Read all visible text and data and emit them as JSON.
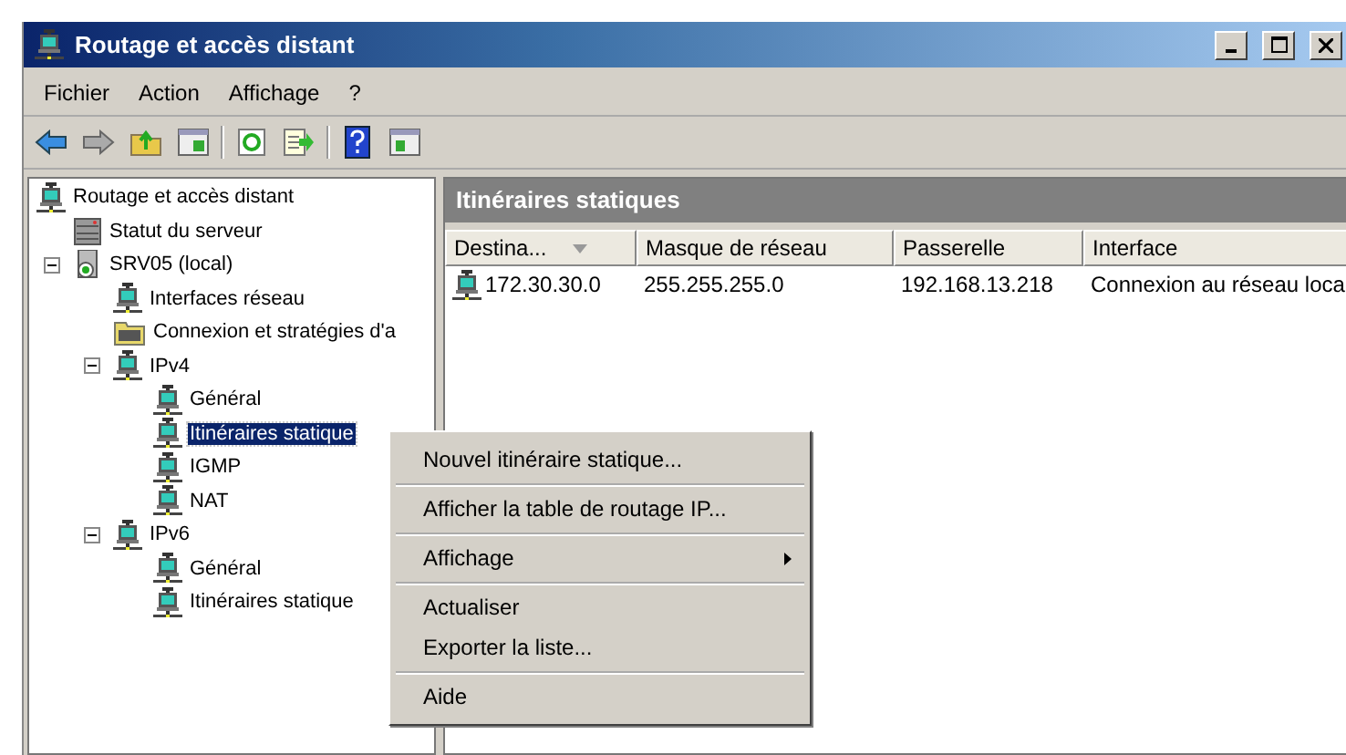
{
  "window": {
    "title": "Routage et accès distant"
  },
  "menu": [
    "Fichier",
    "Action",
    "Affichage",
    "?"
  ],
  "tree": [
    {
      "label": "Routage et accès distant",
      "kind": "network",
      "selected": false,
      "children": [
        {
          "label": "Statut du serveur",
          "kind": "status",
          "selected": false
        },
        {
          "label": "SRV05 (local)",
          "kind": "server",
          "selected": false,
          "expanded": true,
          "children": [
            {
              "label": "Interfaces réseau",
              "kind": "network",
              "selected": false
            },
            {
              "label": "Connexion et stratégies d'a",
              "kind": "folder",
              "selected": false
            },
            {
              "label": "IPv4",
              "kind": "network",
              "selected": false,
              "expanded": true,
              "children": [
                {
                  "label": "Général",
                  "kind": "network",
                  "selected": false
                },
                {
                  "label": "Itinéraires statique",
                  "kind": "network",
                  "selected": true
                },
                {
                  "label": "IGMP",
                  "kind": "network",
                  "selected": false
                },
                {
                  "label": "NAT",
                  "kind": "network",
                  "selected": false
                }
              ]
            },
            {
              "label": "IPv6",
              "kind": "network",
              "selected": false,
              "expanded": true,
              "children": [
                {
                  "label": "Général",
                  "kind": "network",
                  "selected": false
                },
                {
                  "label": "Itinéraires statique",
                  "kind": "network",
                  "selected": false
                }
              ]
            }
          ]
        }
      ]
    }
  ],
  "details": {
    "title": "Itinéraires statiques",
    "columns": [
      {
        "label": "Destina...",
        "sorted": true
      },
      {
        "label": "Masque de réseau",
        "sorted": false
      },
      {
        "label": "Passerelle",
        "sorted": false
      },
      {
        "label": "Interface",
        "sorted": false
      }
    ],
    "rows": [
      [
        "172.30.30.0",
        "255.255.255.0",
        "192.168.13.218",
        "Connexion au réseau loca"
      ]
    ]
  },
  "context_menu": [
    [
      {
        "label": "Nouvel itinéraire statique...",
        "submenu": false
      }
    ],
    [
      {
        "label": "Afficher la table de routage IP...",
        "submenu": false
      }
    ],
    [
      {
        "label": "Affichage",
        "submenu": true
      }
    ],
    [
      {
        "label": "Actualiser",
        "submenu": false
      },
      {
        "label": "Exporter la liste...",
        "submenu": false
      }
    ],
    [
      {
        "label": "Aide",
        "submenu": false
      }
    ]
  ]
}
